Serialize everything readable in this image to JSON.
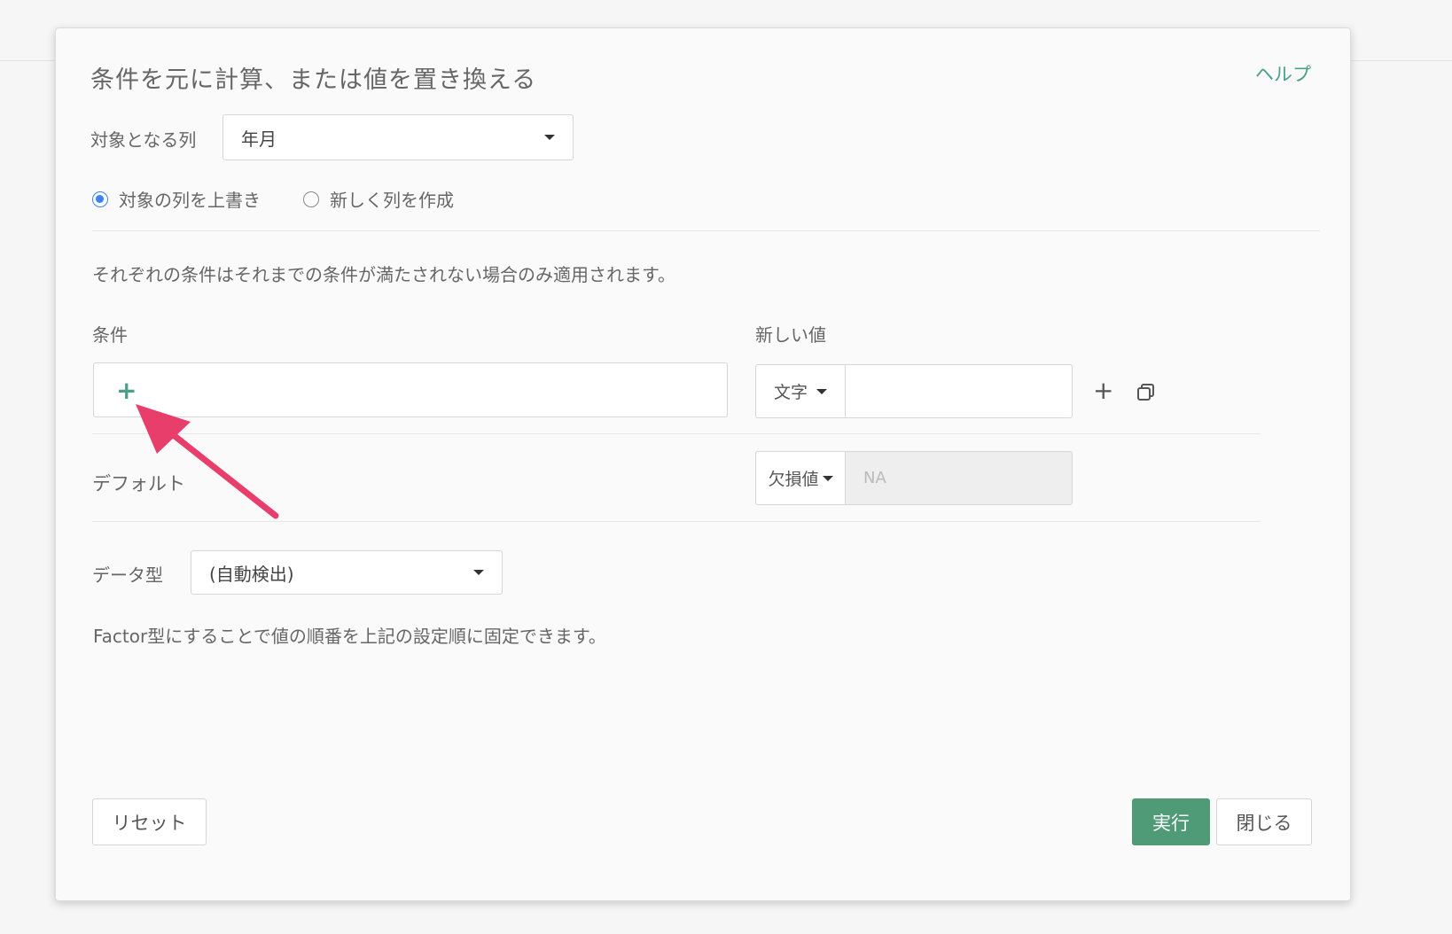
{
  "dialog": {
    "title": "条件を元に計算、または値を置き換える",
    "help_label": "ヘルプ"
  },
  "target_column": {
    "label": "対象となる列",
    "value": "年月"
  },
  "mode": {
    "overwrite_label": "対象の列を上書き",
    "new_column_label": "新しく列を作成",
    "selected": "overwrite"
  },
  "description": "それぞれの条件はそれまでの条件が満たされない場合のみ適用されます。",
  "conditions": {
    "header_condition": "条件",
    "header_new_value": "新しい値",
    "add_symbol": "+",
    "rows": [
      {
        "type_label": "文字",
        "value": ""
      }
    ]
  },
  "default": {
    "label": "デフォルト",
    "type_label": "欠損値",
    "value_placeholder": "NA"
  },
  "data_type": {
    "label": "データ型",
    "value": "(自動検出)"
  },
  "factor_note": "Factor型にすることで値の順番を上記の設定順に固定できます。",
  "footer": {
    "reset_label": "リセット",
    "run_label": "実行",
    "close_label": "閉じる"
  },
  "colors": {
    "accent": "#4aa08a",
    "primary_button": "#4f9b78",
    "radio_selected": "#3b82f6",
    "annotation_arrow": "#e83e6c"
  }
}
